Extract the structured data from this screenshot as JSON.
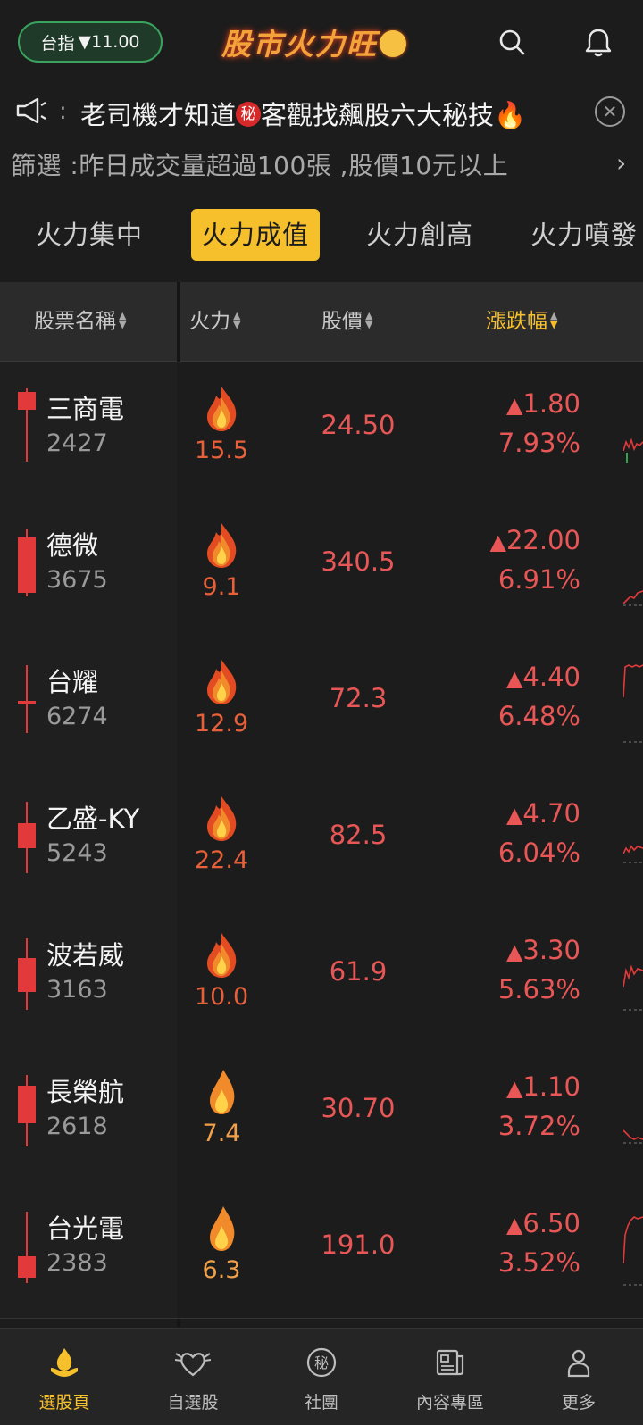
{
  "header": {
    "index_label": "台指",
    "index_change": "▼11.00",
    "app_title": "股市火力旺"
  },
  "notice": {
    "text_before": "老司機才知道",
    "badge": "秘",
    "text_after": "客觀找飆股六大秘技🔥"
  },
  "filter": {
    "text": "篩選 :昨日成交量超過100張 ,股價10元以上"
  },
  "tabs": [
    {
      "label": "火力集中"
    },
    {
      "label": "火力成值"
    },
    {
      "label": "火力創高"
    },
    {
      "label": "火力噴發"
    }
  ],
  "columns": {
    "name": "股票名稱",
    "fire": "火力",
    "price": "股價",
    "change": "漲跌幅"
  },
  "colors": {
    "accent": "#f5c02c",
    "up": "#e85656",
    "fire": "#e8603a",
    "green_pill": "#3aa35e"
  },
  "stocks": [
    {
      "name": "三商電",
      "code": "2427",
      "fire": "15.5",
      "price": "24.50",
      "change": "1.80",
      "pct": "7.93%"
    },
    {
      "name": "德微",
      "code": "3675",
      "fire": "9.1",
      "price": "340.5",
      "change": "22.00",
      "pct": "6.91%"
    },
    {
      "name": "台耀",
      "code": "6274",
      "fire": "12.9",
      "price": "72.3",
      "change": "4.40",
      "pct": "6.48%"
    },
    {
      "name": "乙盛-KY",
      "code": "5243",
      "fire": "22.4",
      "price": "82.5",
      "change": "4.70",
      "pct": "6.04%"
    },
    {
      "name": "波若威",
      "code": "3163",
      "fire": "10.0",
      "price": "61.9",
      "change": "3.30",
      "pct": "5.63%"
    },
    {
      "name": "長榮航",
      "code": "2618",
      "fire": "7.4",
      "price": "30.70",
      "change": "1.10",
      "pct": "3.72%"
    },
    {
      "name": "台光電",
      "code": "2383",
      "fire": "6.3",
      "price": "191.0",
      "change": "6.50",
      "pct": "3.52%"
    }
  ],
  "nav": [
    {
      "label": "選股頁",
      "icon": "stock-picker-icon"
    },
    {
      "label": "自選股",
      "icon": "watchlist-heart-icon"
    },
    {
      "label": "社團",
      "icon": "community-icon"
    },
    {
      "label": "內容專區",
      "icon": "content-icon"
    },
    {
      "label": "更多",
      "icon": "profile-icon"
    }
  ]
}
